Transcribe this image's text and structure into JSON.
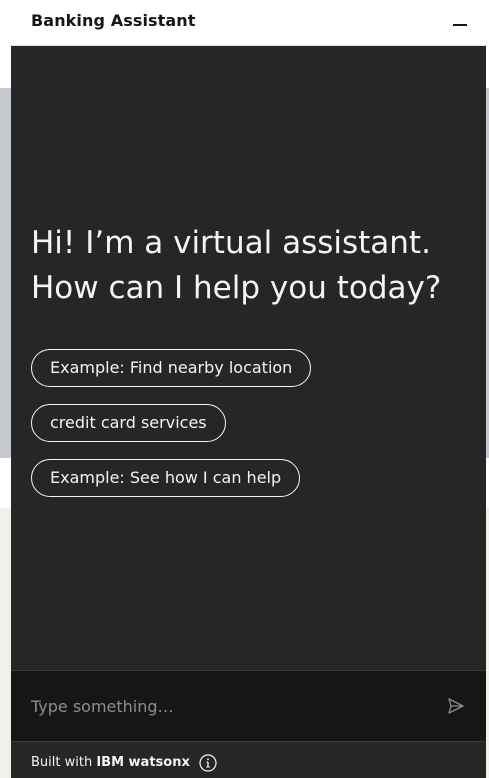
{
  "header": {
    "title": "Banking Assistant",
    "minimize_icon": "minimize-icon"
  },
  "greeting": {
    "line1": "Hi! I’m a virtual assistant.",
    "line2": "How can I help you today?"
  },
  "suggestions": [
    {
      "label": "Example: Find nearby location"
    },
    {
      "label": "credit card services"
    },
    {
      "label": "Example: See how I can help"
    }
  ],
  "input": {
    "value": "",
    "placeholder": "Type something…",
    "send_icon": "send-icon"
  },
  "footer": {
    "prefix": "Built with",
    "brand": "IBM watsonx",
    "info_icon": "info-icon"
  },
  "colors": {
    "panel": "#262626",
    "input_bg": "#161616",
    "text": "#f4f4f4",
    "placeholder": "#8d8d8d",
    "header_bg": "#ffffff"
  }
}
